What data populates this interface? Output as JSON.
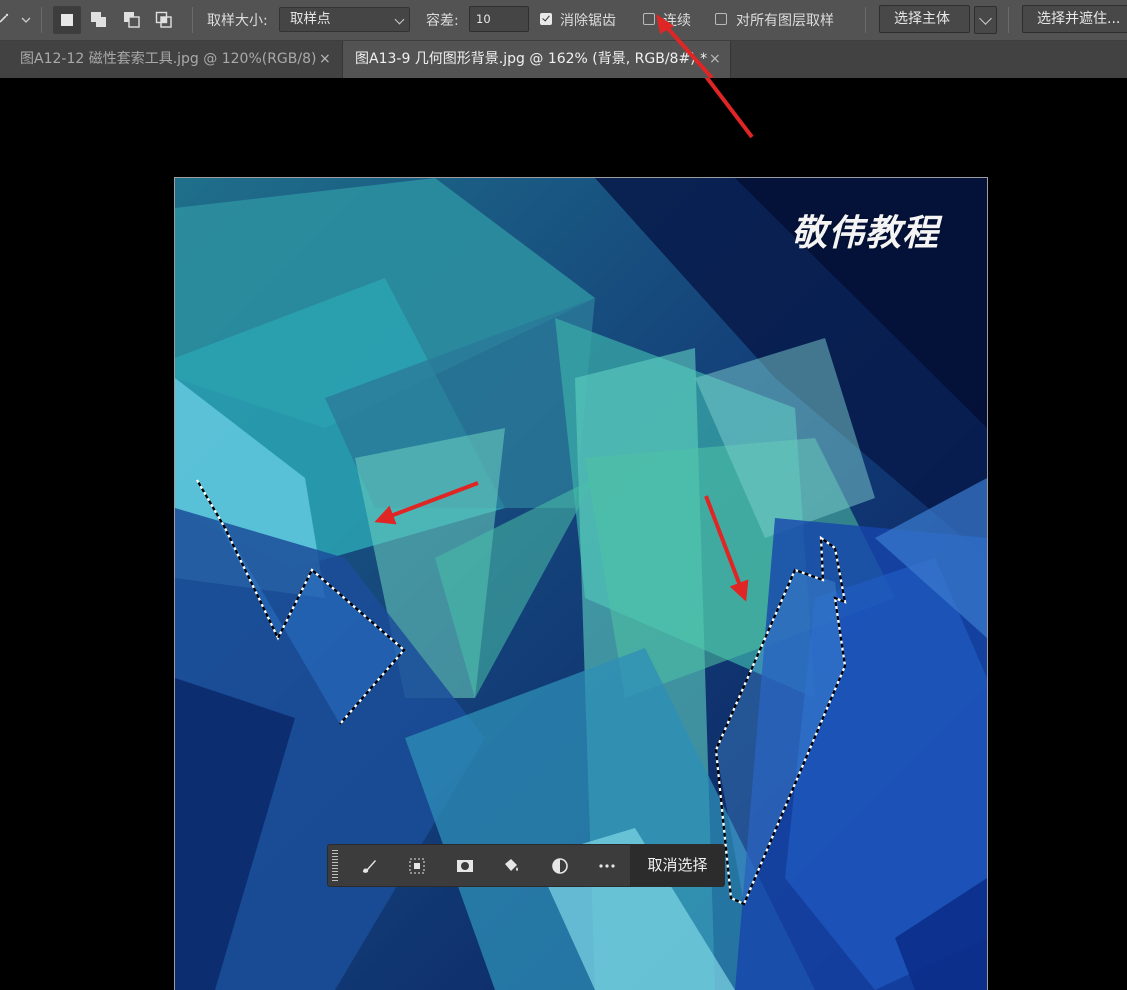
{
  "options_bar": {
    "sample_size_label": "取样大小:",
    "sample_size_value": "取样点",
    "tolerance_label": "容差:",
    "tolerance_value": "10",
    "anti_alias_label": "消除锯齿",
    "anti_alias_checked": true,
    "contiguous_label": "连续",
    "contiguous_checked": false,
    "sample_all_layers_label": "对所有图层取样",
    "sample_all_layers_checked": false,
    "select_subject_label": "选择主体",
    "select_and_mask_label": "选择并遮住..."
  },
  "tabs": [
    {
      "label": "图A12-12 磁性套索工具.jpg @ 120%(RGB/8)",
      "active": false,
      "close": "×"
    },
    {
      "label": "图A13-9 几何图形背景.jpg @ 162% (背景, RGB/8#) *",
      "active": true,
      "close": "×"
    }
  ],
  "canvas": {
    "watermark": "敬伟教程"
  },
  "task_bar": {
    "icons": [
      "brush-icon",
      "select-transform-icon",
      "mask-icon",
      "fill-bucket-icon",
      "adjustment-icon",
      "more-icon"
    ],
    "deselect_label": "取消选择"
  },
  "colors": {
    "options_bg": "#535353",
    "tab_bg": "#424242",
    "active_tab_bg": "#535353",
    "annotation_arrow": "#e02525",
    "canvas_dark_navy": "#0a1a4a"
  }
}
